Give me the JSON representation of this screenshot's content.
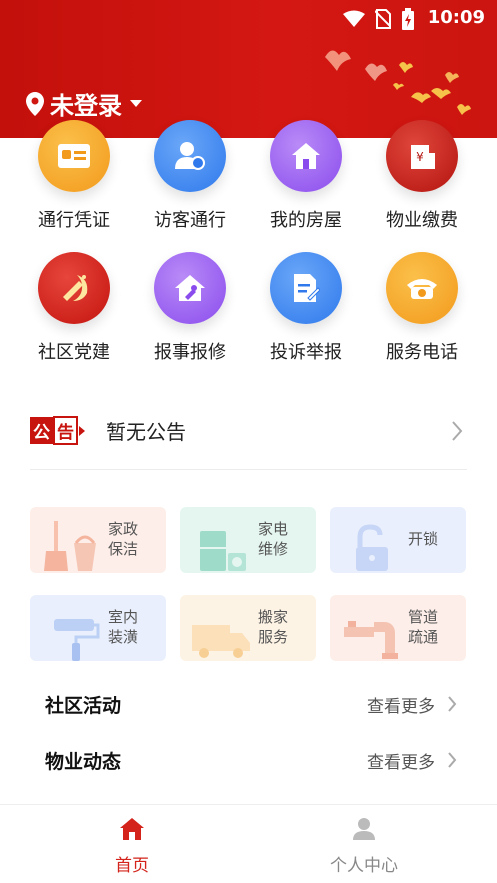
{
  "status_bar": {
    "time": "10:09"
  },
  "header": {
    "location_text": "未登录"
  },
  "grid": {
    "items": [
      {
        "label": "通行凭证",
        "icon": "id-card-icon",
        "color": "#f6a323"
      },
      {
        "label": "访客通行",
        "icon": "visitor-icon",
        "color": "#3f89f2"
      },
      {
        "label": "我的房屋",
        "icon": "house-icon",
        "color": "#9c5cf0"
      },
      {
        "label": "物业缴费",
        "icon": "payment-icon",
        "color": "#c91b14"
      },
      {
        "label": "社区党建",
        "icon": "party-emblem-icon",
        "color": "#d3231a"
      },
      {
        "label": "报事报修",
        "icon": "repair-icon",
        "color": "#9a5df0"
      },
      {
        "label": "投诉举报",
        "icon": "complaint-icon",
        "color": "#3b86f2"
      },
      {
        "label": "服务电话",
        "icon": "phone-icon",
        "color": "#f5a31f"
      }
    ]
  },
  "notice": {
    "badge_1": "公",
    "badge_2": "告",
    "text": "暂无公告"
  },
  "services": {
    "cards": [
      {
        "label_line1": "家政",
        "label_line2": "保洁",
        "bg": "#fdeee9",
        "icon": "cleaning-icon"
      },
      {
        "label_line1": "家电",
        "label_line2": "维修",
        "bg": "#e5f6f1",
        "icon": "appliance-icon"
      },
      {
        "label_line1": "开锁",
        "label_line2": "",
        "bg": "#e9effc",
        "icon": "unlock-icon"
      },
      {
        "label_line1": "室内",
        "label_line2": "装潢",
        "bg": "#e9effc",
        "icon": "paint-roller-icon"
      },
      {
        "label_line1": "搬家",
        "label_line2": "服务",
        "bg": "#fdf3e5",
        "icon": "moving-truck-icon"
      },
      {
        "label_line1": "管道",
        "label_line2": "疏通",
        "bg": "#fdeee9",
        "icon": "pipe-icon"
      }
    ]
  },
  "sections": {
    "community": {
      "title": "社区活动",
      "more": "查看更多"
    },
    "property": {
      "title": "物业动态",
      "more": "查看更多"
    }
  },
  "bottom_nav": {
    "home": {
      "label": "首页",
      "color": "#d3231a"
    },
    "profile": {
      "label": "个人中心",
      "color": "#888888"
    }
  }
}
